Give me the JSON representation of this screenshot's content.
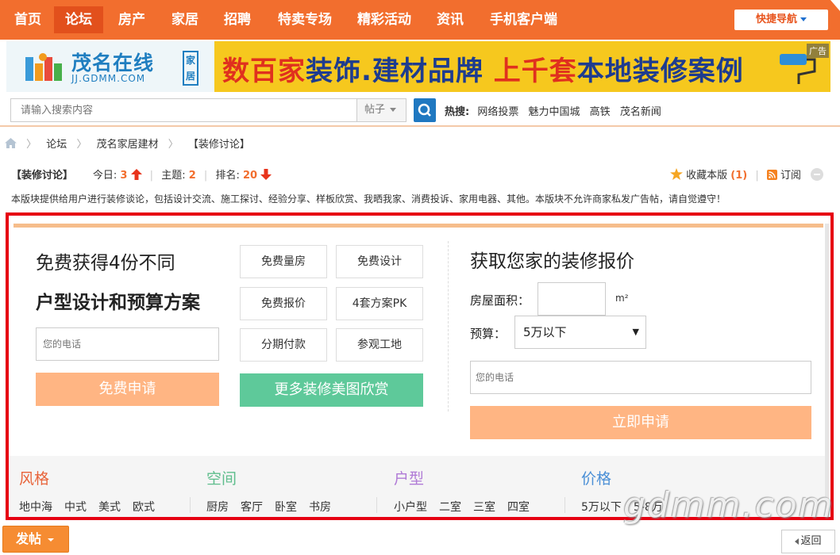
{
  "nav": {
    "items": [
      "首页",
      "论坛",
      "房产",
      "家居",
      "招聘",
      "特卖专场",
      "精彩活动",
      "资讯",
      "手机客户端"
    ],
    "active_index": 1,
    "quick_nav": "快捷导航"
  },
  "banner": {
    "logo_text": "茂名在线",
    "logo_sub": "JJ.GDMM.COM",
    "logo_tag": "家居",
    "slogan_a": "数百家",
    "slogan_b": "装饰.建材品牌 ",
    "slogan_c": "上千套",
    "slogan_d": "本地装修案例",
    "ad_tag": "广告"
  },
  "search": {
    "placeholder": "请输入搜索内容",
    "scope": "帖子",
    "hot_label": "热搜:",
    "hot_links": [
      "网络投票",
      "魅力中国城",
      "高铁",
      "茂名新闻"
    ]
  },
  "breadcrumb": [
    "论坛",
    "茂名家居建材",
    "【装修讨论】"
  ],
  "forum": {
    "title": "【装修讨论】",
    "today_label": "今日:",
    "today": "3",
    "topics_label": "主题:",
    "topics": "2",
    "rank_label": "排名:",
    "rank": "20",
    "favorite_label": "收藏本版",
    "favorite_count": "(1)",
    "subscribe_label": "订阅",
    "description": "本版块提供给用户进行装修谈论，包括设计交流、施工探讨、经验分享、样板欣赏、我晒我家、消费投诉、家用电器、其他。本版块不允许商家私发广告帖，请自觉遵守！"
  },
  "promo": {
    "left_title1": "免费获得4份不同",
    "left_title2": "户型设计和预算方案",
    "left_phone_placeholder": "您的电话",
    "left_button": "免费申请",
    "options": [
      "免费量房",
      "免费设计",
      "免费报价",
      "4套方案PK",
      "分期付款",
      "参观工地"
    ],
    "more_button": "更多装修美图欣赏",
    "right_title": "获取您家的装修报价",
    "area_label": "房屋面积：",
    "area_unit": "m²",
    "budget_label": "预算：",
    "budget_value": "5万以下",
    "right_phone_placeholder": "您的电话",
    "right_button": "立即申请"
  },
  "categories": [
    {
      "title": "风格",
      "color": "#e8643a",
      "items": [
        "地中海",
        "中式",
        "美式",
        "欧式"
      ]
    },
    {
      "title": "空间",
      "color": "#5ebd8c",
      "items": [
        "厨房",
        "客厅",
        "卧室",
        "书房"
      ]
    },
    {
      "title": "户型",
      "color": "#b07ad6",
      "items": [
        "小户型",
        "二室",
        "三室",
        "四室"
      ]
    },
    {
      "title": "价格",
      "color": "#4a8fd6",
      "items": [
        "5万以下",
        "5-8万"
      ]
    }
  ],
  "watermark": "gdmm.com",
  "footer": {
    "post_button": "发帖",
    "back_button": "返回"
  }
}
